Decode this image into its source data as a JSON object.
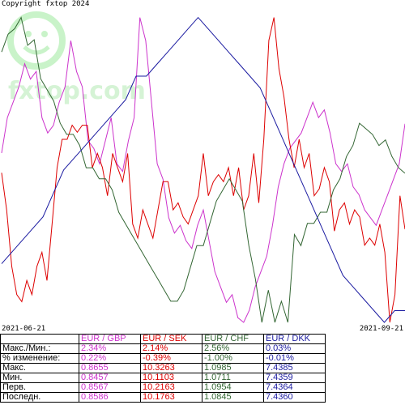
{
  "copyright": "Copyright fxtop 2024",
  "watermark": "fxtop.com",
  "dates": {
    "start": "2021-06-21",
    "end": "2021-09-21"
  },
  "colors": {
    "gbp": "#cc33cc",
    "sek": "#dd0000",
    "chf": "#336633",
    "dkk": "#1a1aa0",
    "table_bg": "#e0e0e0"
  },
  "chart_data": {
    "type": "line",
    "title": "",
    "xlabel": "",
    "ylabel": "",
    "normalization": "each series scaled between its own min and max",
    "x": [
      "2021-06-21",
      "2021-09-21"
    ],
    "series": [
      {
        "name": "EUR / GBP",
        "color": "#cc33cc",
        "values": [
          0.8567,
          0.859,
          0.86,
          0.861,
          0.8625,
          0.8615,
          0.862,
          0.859,
          0.858,
          0.8585,
          0.86,
          0.861,
          0.864,
          0.862,
          0.861,
          0.8575,
          0.857,
          0.856,
          0.8575,
          0.859,
          0.856,
          0.8555,
          0.8575,
          0.859,
          0.8655,
          0.864,
          0.86,
          0.856,
          0.855,
          0.8525,
          0.8515,
          0.852,
          0.851,
          0.8505,
          0.852,
          0.853,
          0.851,
          0.849,
          0.848,
          0.847,
          0.8475,
          0.846,
          0.8457,
          0.8465,
          0.848,
          0.849,
          0.85,
          0.852,
          0.8545,
          0.856,
          0.857,
          0.8575,
          0.858,
          0.859,
          0.86,
          0.859,
          0.8595,
          0.858,
          0.856,
          0.8555,
          0.856,
          0.8545,
          0.854,
          0.853,
          0.8525,
          0.852,
          0.853,
          0.854,
          0.855,
          0.856,
          0.8586
        ]
      },
      {
        "name": "EUR / SEK",
        "color": "#dd0000",
        "values": [
          10.2163,
          10.19,
          10.15,
          10.13,
          10.125,
          10.14,
          10.13,
          10.15,
          10.16,
          10.14,
          10.18,
          10.22,
          10.24,
          10.24,
          10.25,
          10.245,
          10.25,
          10.25,
          10.22,
          10.23,
          10.22,
          10.2,
          10.23,
          10.22,
          10.21,
          10.23,
          10.18,
          10.17,
          10.19,
          10.18,
          10.17,
          10.19,
          10.21,
          10.21,
          10.19,
          10.195,
          10.185,
          10.18,
          10.19,
          10.2,
          10.23,
          10.2,
          10.21,
          10.215,
          10.21,
          10.22,
          10.2,
          10.22,
          10.19,
          10.2,
          10.23,
          10.195,
          10.24,
          10.31,
          10.3263,
          10.29,
          10.27,
          10.24,
          10.22,
          10.24,
          10.22,
          10.23,
          10.2,
          10.205,
          10.22,
          10.21,
          10.175,
          10.19,
          10.195,
          10.18,
          10.19,
          10.185,
          10.165,
          10.17,
          10.165,
          10.18,
          10.16,
          10.1103,
          10.13,
          10.2,
          10.1763
        ]
      },
      {
        "name": "EUR / CHF",
        "color": "#336633",
        "values": [
          1.0954,
          1.097,
          1.0975,
          1.0985,
          1.096,
          1.0965,
          1.093,
          1.092,
          1.091,
          1.089,
          1.088,
          1.088,
          1.087,
          1.085,
          1.085,
          1.084,
          1.084,
          1.083,
          1.081,
          1.08,
          1.079,
          1.078,
          1.077,
          1.076,
          1.075,
          1.074,
          1.073,
          1.073,
          1.074,
          1.076,
          1.078,
          1.078,
          1.08,
          1.082,
          1.083,
          1.084,
          1.083,
          1.082,
          1.078,
          1.075,
          1.0711,
          1.074,
          1.0711,
          1.073,
          1.0711,
          1.079,
          1.078,
          1.08,
          1.08,
          1.081,
          1.081,
          1.083,
          1.084,
          1.086,
          1.087,
          1.089,
          1.0885,
          1.088,
          1.087,
          1.0875,
          1.086,
          1.085,
          1.0845
        ]
      },
      {
        "name": "EUR / DKK",
        "color": "#1a1aa0",
        "values": [
          7.4364,
          7.4365,
          7.4366,
          7.4367,
          7.4368,
          7.437,
          7.4372,
          7.4373,
          7.4374,
          7.4375,
          7.4376,
          7.4377,
          7.4378,
          7.438,
          7.438,
          7.4381,
          7.4382,
          7.4383,
          7.4384,
          7.4385,
          7.4384,
          7.4383,
          7.4382,
          7.4381,
          7.438,
          7.4379,
          7.4377,
          7.4375,
          7.4373,
          7.4371,
          7.4369,
          7.4367,
          7.4365,
          7.4363,
          7.4362,
          7.4361,
          7.436,
          7.4359,
          7.436,
          7.436
        ]
      }
    ]
  },
  "table": {
    "headers": [
      "",
      "EUR / GBP",
      "EUR / SEK",
      "EUR / CHF",
      "EUR / DKK"
    ],
    "rows": [
      {
        "label": "Макс./Мин.:",
        "values": [
          "2.34%",
          "2.14%",
          "2.56%",
          "0.03%"
        ]
      },
      {
        "label": "% изменение:",
        "values": [
          "0.22%",
          "-0.39%",
          "-1.00%",
          "-0.01%"
        ]
      },
      {
        "label": "Макс.",
        "values": [
          "0.8655",
          "10.3263",
          "1.0985",
          "7.4385"
        ]
      },
      {
        "label": "Мин.",
        "values": [
          "0.8457",
          "10.1103",
          "1.0711",
          "7.4359"
        ]
      },
      {
        "label": "Перв.",
        "values": [
          "0.8567",
          "10.2163",
          "1.0954",
          "7.4364"
        ]
      },
      {
        "label": "Последн.",
        "values": [
          "0.8586",
          "10.1763",
          "1.0845",
          "7.4360"
        ]
      }
    ]
  }
}
